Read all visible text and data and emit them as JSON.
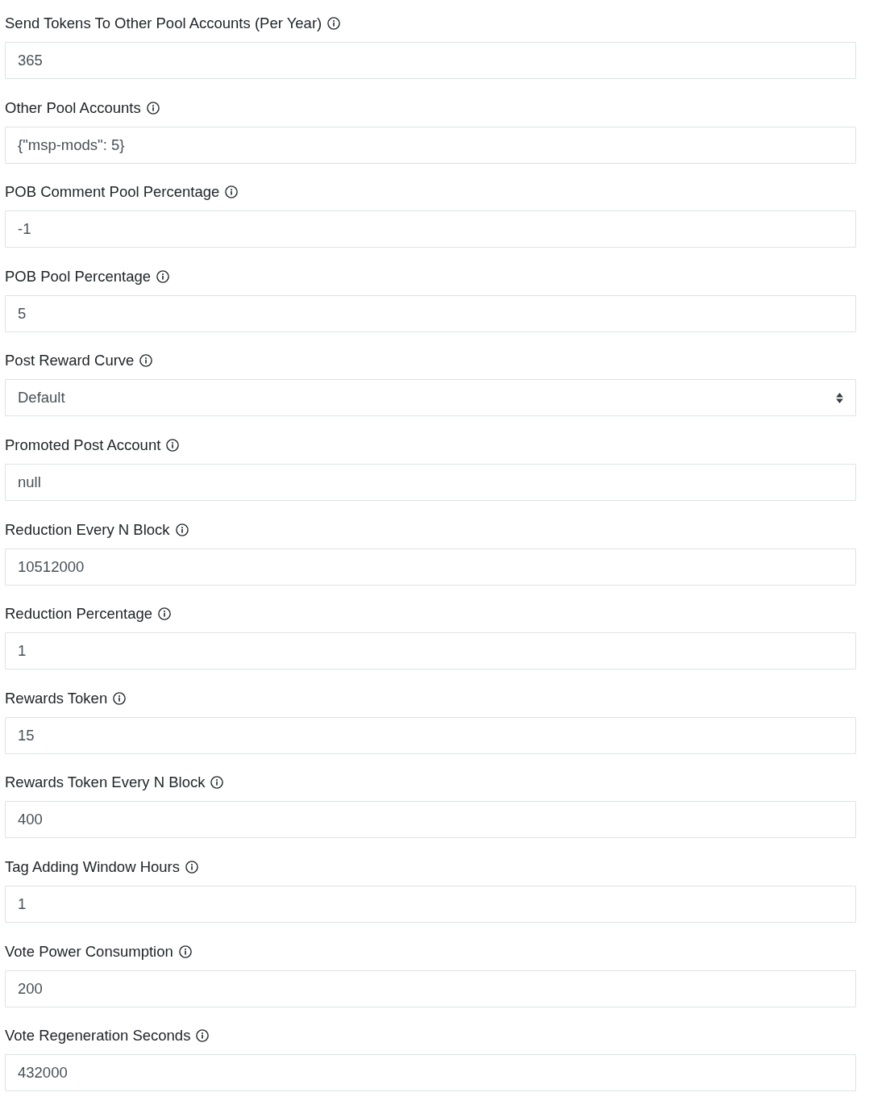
{
  "fields": [
    {
      "kind": "input",
      "label": "Send Tokens To Other Pool Accounts (Per Year)",
      "value": "365"
    },
    {
      "kind": "input",
      "label": "Other Pool Accounts",
      "value": "{\"msp-mods\": 5}"
    },
    {
      "kind": "input",
      "label": "POB Comment Pool Percentage",
      "value": "-1"
    },
    {
      "kind": "input",
      "label": "POB Pool Percentage",
      "value": "5"
    },
    {
      "kind": "select",
      "label": "Post Reward Curve",
      "value": "Default"
    },
    {
      "kind": "input",
      "label": "Promoted Post Account",
      "value": "null"
    },
    {
      "kind": "input",
      "label": "Reduction Every N Block",
      "value": "10512000"
    },
    {
      "kind": "input",
      "label": "Reduction Percentage",
      "value": "1"
    },
    {
      "kind": "input",
      "label": "Rewards Token",
      "value": "15"
    },
    {
      "kind": "input",
      "label": "Rewards Token Every N Block",
      "value": "400"
    },
    {
      "kind": "input",
      "label": "Tag Adding Window Hours",
      "value": "1"
    },
    {
      "kind": "input",
      "label": "Vote Power Consumption",
      "value": "200"
    },
    {
      "kind": "input",
      "label": "Vote Regeneration Seconds",
      "value": "432000"
    }
  ]
}
